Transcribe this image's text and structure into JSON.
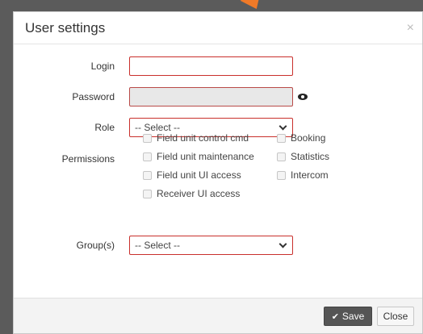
{
  "modal": {
    "title": "User settings",
    "close_glyph": "×"
  },
  "form": {
    "login": {
      "label": "Login",
      "value": "",
      "placeholder": ""
    },
    "password": {
      "label": "Password",
      "value": "",
      "placeholder": ""
    },
    "role": {
      "label": "Role",
      "selected": "-- Select --"
    },
    "permissions": {
      "label": "Permissions",
      "items": [
        {
          "label": "Field unit control cmd",
          "checked": false
        },
        {
          "label": "Booking",
          "checked": false
        },
        {
          "label": "Field unit maintenance",
          "checked": false
        },
        {
          "label": "Statistics",
          "checked": false
        },
        {
          "label": "Field unit UI access",
          "checked": false
        },
        {
          "label": "Intercom",
          "checked": false
        },
        {
          "label": "Receiver UI access",
          "checked": false
        }
      ]
    },
    "groups": {
      "label": "Group(s)",
      "selected": "-- Select --"
    }
  },
  "footer": {
    "save_label": "Save",
    "close_label": "Close"
  },
  "icons": {
    "close": "close-icon",
    "eye": "eye-icon",
    "check": "check-icon",
    "chevron": "chevron-down-icon"
  },
  "colors": {
    "accent": "#f07a28",
    "error_border": "#c9302c",
    "save_bg": "#555555"
  }
}
